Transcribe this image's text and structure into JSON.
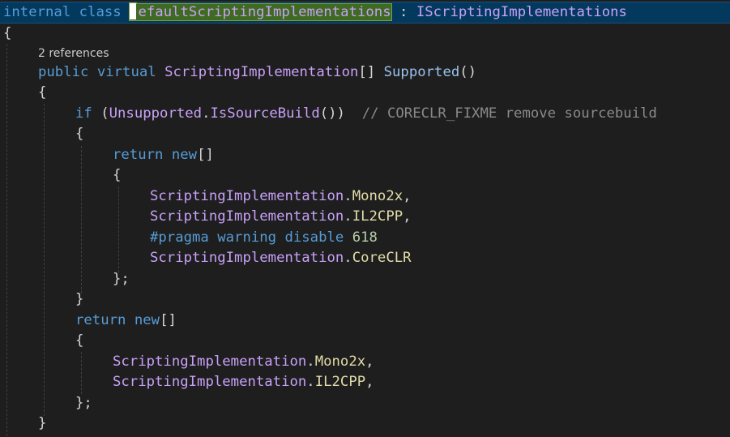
{
  "codelens": {
    "references": "2 references"
  },
  "code": {
    "l1": {
      "internal": "internal",
      "class": "class",
      "class_name": "efaultScriptingImplementations",
      "colon": " : ",
      "interface": "IScriptingImplementations"
    },
    "l2": {
      "brace": "{"
    },
    "l3": {
      "public": "public",
      "virtual": "virtual",
      "return_type": "ScriptingImplementation",
      "array": "[]",
      "method": "Supported",
      "parens": "()"
    },
    "l4": {
      "brace": "{"
    },
    "l5": {
      "if": "if",
      "open": " (",
      "type": "Unsupported",
      "dot": ".",
      "method": "IsSourceBuild",
      "close": "())",
      "comment": "// CORECLR_FIXME remove sourcebuild"
    },
    "l6": {
      "brace": "{"
    },
    "l7": {
      "return": "return",
      "new": "new",
      "array": "[]"
    },
    "l8": {
      "brace": "{"
    },
    "l9": {
      "type": "ScriptingImplementation",
      "dot": ".",
      "member": "Mono2x",
      "comma": ","
    },
    "l10": {
      "type": "ScriptingImplementation",
      "dot": ".",
      "member": "IL2CPP",
      "comma": ","
    },
    "l11": {
      "pragma": "#pragma warning disable",
      "number": "618"
    },
    "l12": {
      "type": "ScriptingImplementation",
      "dot": ".",
      "member": "CoreCLR"
    },
    "l13": {
      "close": "};"
    },
    "l14": {
      "brace": "}"
    },
    "l15": {
      "return": "return",
      "new": "new",
      "array": "[]"
    },
    "l16": {
      "brace": "{"
    },
    "l17": {
      "type": "ScriptingImplementation",
      "dot": ".",
      "member": "Mono2x",
      "comma": ","
    },
    "l18": {
      "type": "ScriptingImplementation",
      "dot": ".",
      "member": "IL2CPP",
      "comma": ","
    },
    "l19": {
      "close": "};"
    },
    "l20": {
      "brace": "}"
    }
  }
}
